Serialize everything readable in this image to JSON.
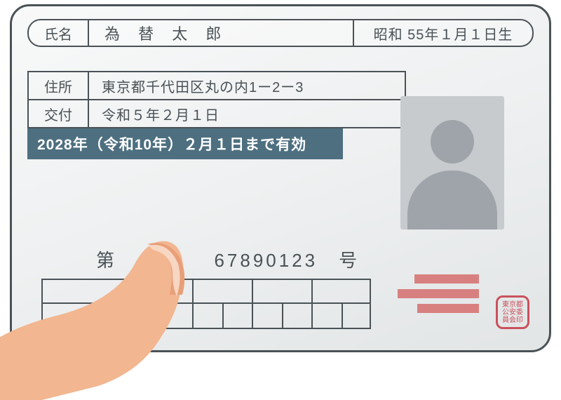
{
  "name_label": "氏名",
  "name_value": "為 替 太 郎",
  "dob": "昭和 55年１月１日生",
  "info": [
    {
      "label": "住所",
      "value": "東京都千代田区丸の内1ー2ー3"
    },
    {
      "label": "交付",
      "value": "令和５年２月１日"
    }
  ],
  "expiry": "2028年（令和10年）２月１日まで有効",
  "license_number_line": "第　1　　　67890123　号",
  "seal_text": "東京都公安委員会印"
}
